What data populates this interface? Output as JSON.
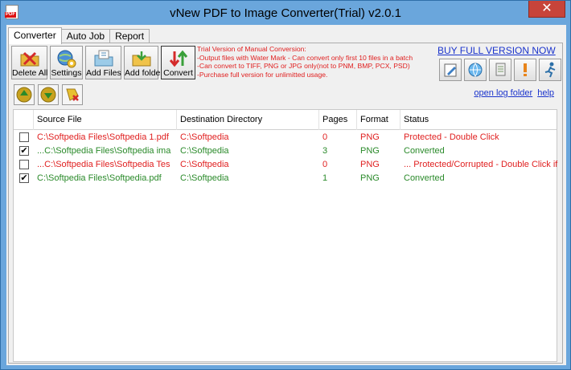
{
  "window": {
    "title": "vNew PDF to Image Converter(Trial) v2.0.1",
    "close_glyph": "✕"
  },
  "tabs": [
    {
      "label": "Converter"
    },
    {
      "label": "Auto Job"
    },
    {
      "label": "Report"
    }
  ],
  "toolbar": {
    "delete_all": "Delete All",
    "settings": "Settings",
    "add_files": "Add Files",
    "add_folder": "Add folder",
    "convert": "Convert"
  },
  "trial": {
    "line1": "Trial Version of Manual Conversion:",
    "line2": "-Output files with Water Mark - Can convert only first 10 files in a batch",
    "line3": "-Can convert to TIFF, PNG or JPG only(not to PNM, BMP, PCX, PSD)",
    "line4": "-Purchase full version for unlimitted usage."
  },
  "buy_link": "BUY FULL VERSION NOW",
  "links": {
    "open_log": "open log folder",
    "help": "help"
  },
  "table": {
    "columns": [
      "Source File",
      "Destination Directory",
      "Pages",
      "Format",
      "Status"
    ],
    "rows": [
      {
        "checked": false,
        "source": "C:\\Softpedia Files\\Softpedia 1.pdf",
        "dest": "C:\\Softpedia",
        "pages": "0",
        "format": "PNG",
        "status": "Protected - Double Click",
        "color": "red"
      },
      {
        "checked": true,
        "source": "...C:\\Softpedia Files\\Softpedia ima",
        "dest": "C:\\Softpedia",
        "pages": "3",
        "format": "PNG",
        "status": "Converted",
        "color": "green"
      },
      {
        "checked": false,
        "source": "...C:\\Softpedia Files\\Softpedia Tes",
        "dest": "C:\\Softpedia",
        "pages": "0",
        "format": "PNG",
        "status": "... Protected/Corrupted - Double Click if",
        "color": "red"
      },
      {
        "checked": true,
        "source": "C:\\Softpedia Files\\Softpedia.pdf",
        "dest": "C:\\Softpedia",
        "pages": "1",
        "format": "PNG",
        "status": "Converted",
        "color": "green"
      }
    ]
  },
  "colors": {
    "title_bar": "#6aa6dc",
    "close": "#c7443a",
    "error": "#e02020",
    "ok": "#2a8a2a",
    "link": "#1a33cc"
  }
}
